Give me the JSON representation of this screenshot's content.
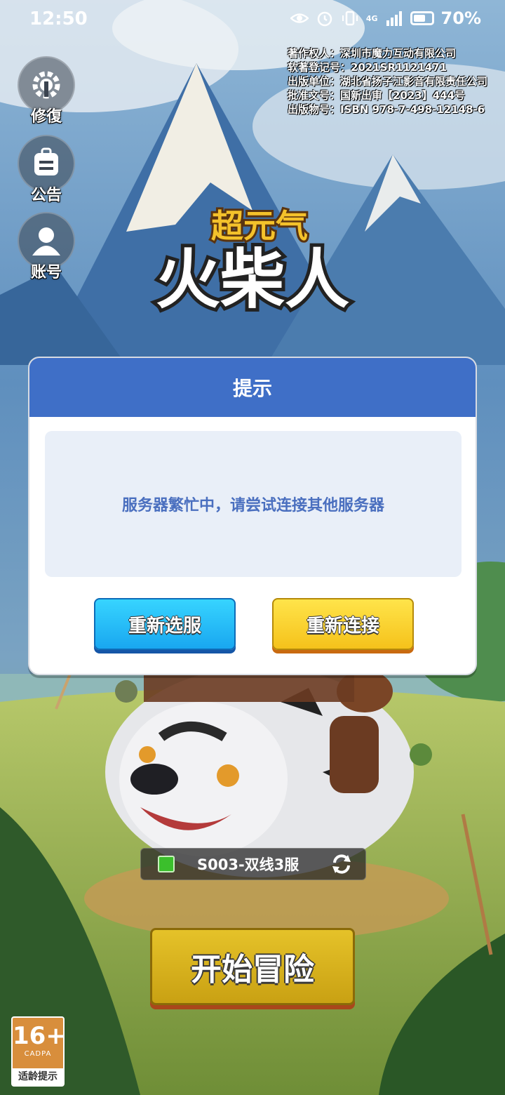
{
  "status_bar": {
    "time": "12:50",
    "network": "4G",
    "battery": "70%"
  },
  "copyright": [
    "著作权人：深圳市魔力互动有限公司",
    "软著登记号：2021SR1121471",
    "出版单位：湖北省扬子江影音有限责任公司",
    "批准文号：国新出审【2023】444号",
    "出版物号：ISBN 978-7-498-12148-6"
  ],
  "side_buttons": [
    {
      "label": "修復",
      "icon": "gear-wrench-icon"
    },
    {
      "label": "公告",
      "icon": "notice-board-icon"
    },
    {
      "label": "账号",
      "icon": "user-icon"
    }
  ],
  "logo": {
    "line1": "超元气",
    "line2": "火柴人"
  },
  "dialog": {
    "title": "提示",
    "message": "服务器繁忙中，请尝试连接其他服务器",
    "buttons": {
      "reselect": "重新选服",
      "reconnect": "重新连接"
    }
  },
  "server": {
    "name": "S003-双线3服",
    "status_color": "#3bbf2c"
  },
  "start_button": "开始冒险",
  "age_rating": {
    "number": "16+",
    "org": "CADPA",
    "tip": "适龄提示"
  },
  "colors": {
    "dialog_header": "#3f6fc7",
    "message_text": "#4a6fbf",
    "blue_button": "#19a7f0",
    "yellow_button": "#f5c21b",
    "start_button": "#d4ae1b"
  }
}
